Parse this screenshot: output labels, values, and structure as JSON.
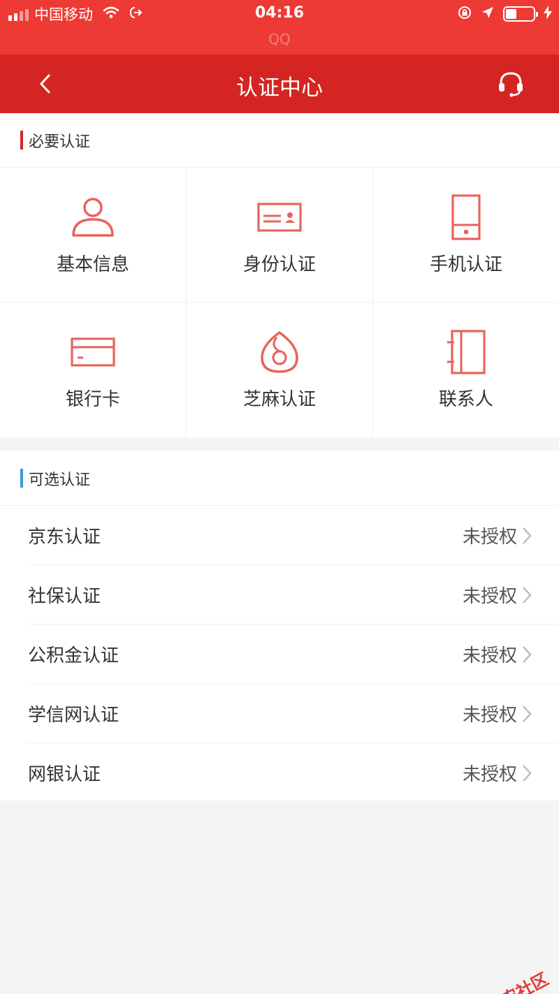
{
  "status_bar": {
    "carrier": "中国移动",
    "time": "04:16",
    "source_app": "QQ",
    "battery_level": 0.4
  },
  "nav": {
    "title": "认证中心",
    "back_icon": "chevron-left-icon",
    "support_icon": "headset-icon"
  },
  "colors": {
    "status_bar": "#ee3a34",
    "nav_bar": "#d52522",
    "accent_required": "#d52522",
    "accent_optional": "#3b9bd8",
    "icon_stroke": "#e8635c"
  },
  "required": {
    "title": "必要认证",
    "items": [
      {
        "label": "基本信息",
        "icon": "person-icon"
      },
      {
        "label": "身份认证",
        "icon": "id-card-icon"
      },
      {
        "label": "手机认证",
        "icon": "phone-icon"
      },
      {
        "label": "银行卡",
        "icon": "bank-card-icon"
      },
      {
        "label": "芝麻认证",
        "icon": "sesame-icon"
      },
      {
        "label": "联系人",
        "icon": "contacts-book-icon"
      }
    ]
  },
  "optional": {
    "title": "可选认证",
    "items": [
      {
        "label": "京东认证",
        "status": "未授权"
      },
      {
        "label": "社保认证",
        "status": "未授权"
      },
      {
        "label": "公积金认证",
        "status": "未授权"
      },
      {
        "label": "学信网认证",
        "status": "未授权"
      },
      {
        "label": "网银认证",
        "status": "未授权"
      }
    ]
  },
  "watermark": {
    "text": "卡农社区"
  }
}
